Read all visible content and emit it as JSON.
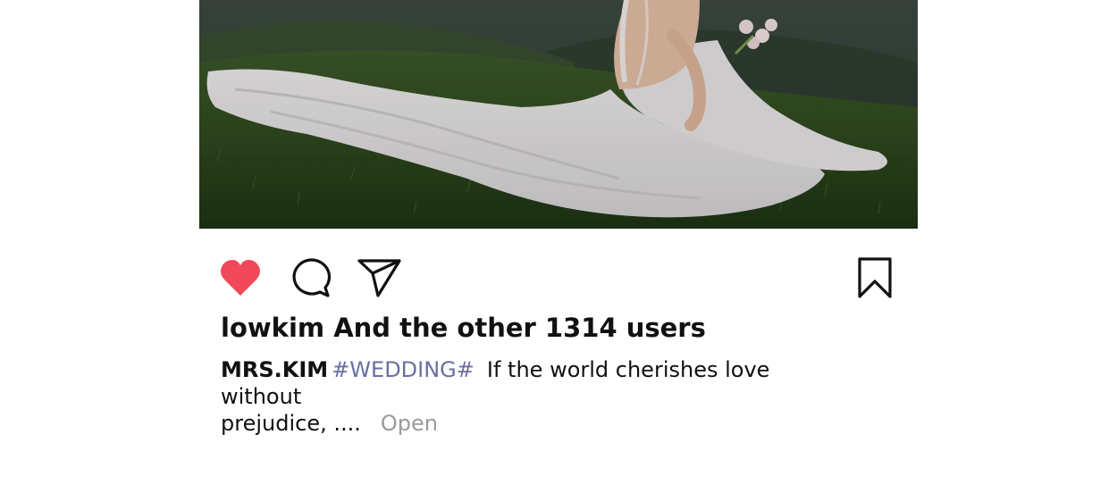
{
  "post": {
    "likes_text": "lowkim And the other 1314 users",
    "caption": {
      "username": "MRS.KIM",
      "hashtag": "#WEDDING#",
      "text_line1": "If the world cherishes love without",
      "text_line2": "prejudice, ....",
      "open_label": "Open"
    },
    "liked": true
  },
  "icons": {
    "like": "heart-icon",
    "comment": "comment-bubble-icon",
    "share": "paper-plane-icon",
    "save": "bookmark-icon"
  },
  "colors": {
    "like_active": "#f1485a",
    "hashtag": "#6a6fa3",
    "open_link": "#9a9a9a",
    "text": "#111111"
  }
}
